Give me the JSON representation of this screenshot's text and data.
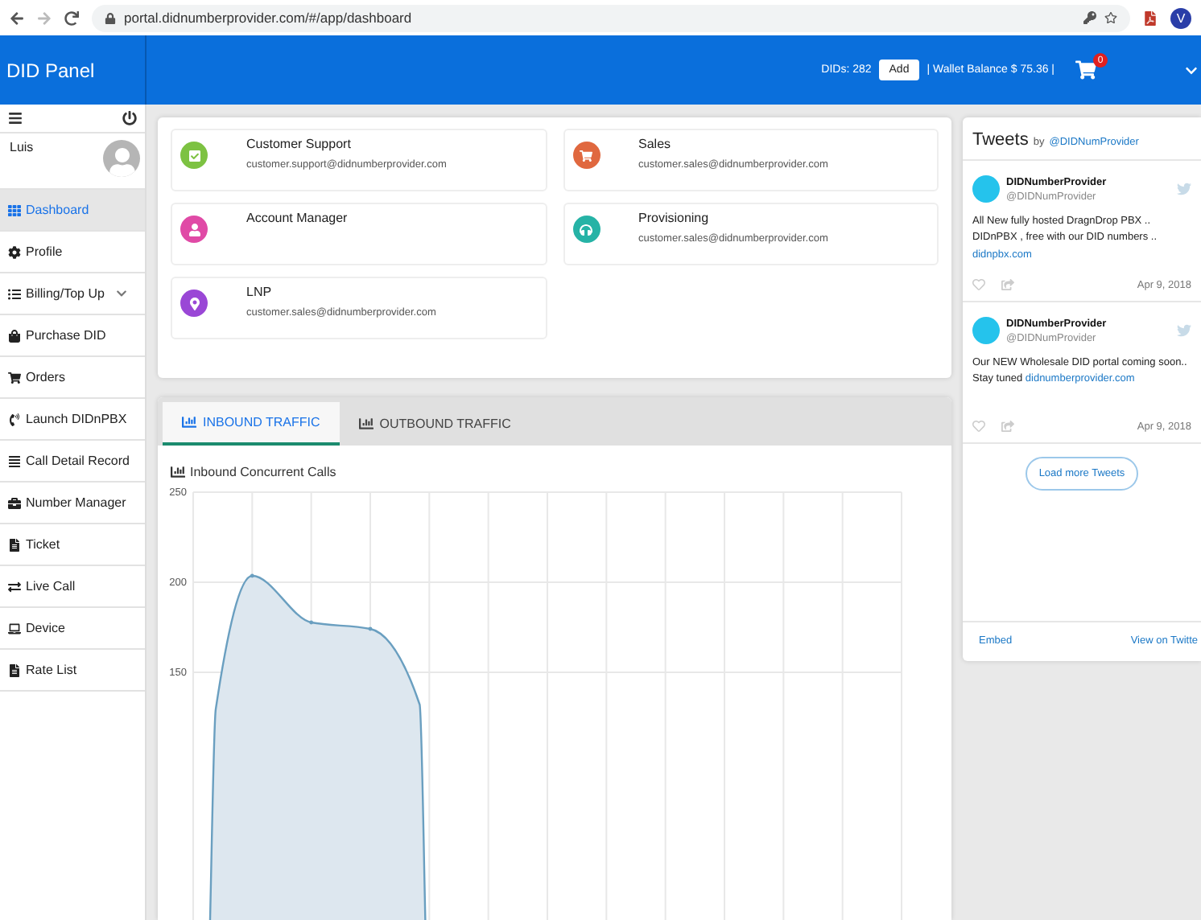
{
  "browser": {
    "url": "portal.didnumberprovider.com/#/app/dashboard",
    "profile_initial": "V"
  },
  "header": {
    "title": "DID Panel",
    "dids": "DIDs: 282",
    "add_button": "Add",
    "wallet": "| Wallet Balance $ 75.36 |",
    "cart_count": "0"
  },
  "sidebar": {
    "user": "Luis",
    "items": [
      {
        "label": "Dashboard",
        "selected": true
      },
      {
        "label": "Profile",
        "selected": false
      },
      {
        "label": "Billing/Top Up",
        "selected": false,
        "expanded": false
      },
      {
        "label": "Purchase DID",
        "selected": false
      },
      {
        "label": "Orders",
        "selected": false
      },
      {
        "label": "Launch DIDnPBX",
        "selected": false
      },
      {
        "label": "Call Detail Record",
        "selected": false
      },
      {
        "label": "Number Manager",
        "selected": false
      },
      {
        "label": "Ticket",
        "selected": false
      },
      {
        "label": "Live Call",
        "selected": false
      },
      {
        "label": "Device",
        "selected": false
      },
      {
        "label": "Rate List",
        "selected": false
      }
    ]
  },
  "contacts": [
    {
      "name": "Customer Support",
      "email": "customer.support@didnumberprovider.com",
      "color": "#7dc242"
    },
    {
      "name": "Sales",
      "email": "customer.sales@didnumberprovider.com",
      "color": "#e0683f"
    },
    {
      "name": "Account Manager",
      "color": "#e04aa6"
    },
    {
      "name": "Provisioning",
      "email": "customer.sales@didnumberprovider.com",
      "color": "#26b3a6"
    },
    {
      "name": "LNP",
      "email": "customer.sales@didnumberprovider.com",
      "color": "#9a47d6"
    }
  ],
  "traffic": {
    "tabs": [
      {
        "label": "INBOUND TRAFFIC",
        "selected": true
      },
      {
        "label": "OUTBOUND TRAFFIC",
        "selected": false
      }
    ],
    "chart": {
      "title": "Inbound Concurrent Calls",
      "y_labels": [
        "250",
        "200",
        "150"
      ]
    }
  },
  "tweets": {
    "title": "Tweets",
    "by": "by",
    "handle_link": "@DIDNumProvider",
    "items": [
      {
        "name": "DIDNumberProvider",
        "handle": "@DIDNumProvider",
        "text": "All New fully hosted DragnDrop PBX .. DIDnPBX , free with our DID numbers ..",
        "link": "didnpbx.com",
        "date": "Apr 9, 2018"
      },
      {
        "name": "DIDNumberProvider",
        "handle": "@DIDNumProvider",
        "text": "Our NEW Wholesale DID portal coming soon.. Stay tuned",
        "link": "didnumberprovider.com",
        "date": "Apr 9, 2018"
      }
    ],
    "load_more": "Load more Tweets",
    "embed": "Embed",
    "view_on": "View on Twitte"
  }
}
